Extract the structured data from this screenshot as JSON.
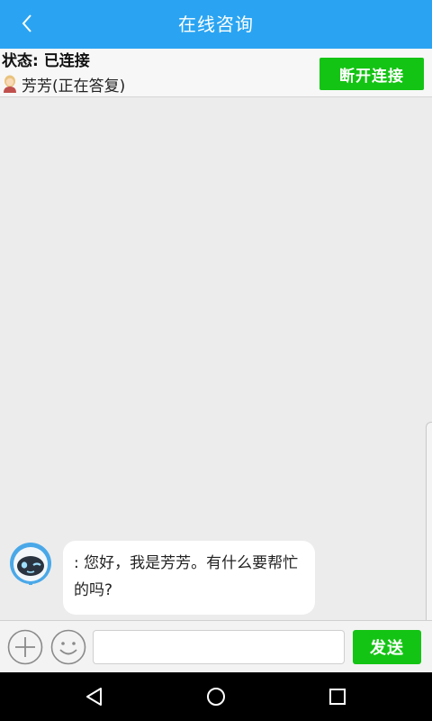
{
  "appbar": {
    "title": "在线咨询",
    "back_icon": "chevron-left-icon",
    "color": "#2aa4f2"
  },
  "status": {
    "connection_label": "状态: 已连接",
    "agent_name": "芳芳",
    "agent_state": " (正在答复)",
    "agent_icon": "user-avatar-icon",
    "disconnect_label": "断开连接",
    "button_color": "#14c414"
  },
  "chat": {
    "messages": [
      {
        "sender_icon": "robot-avatar-icon",
        "text": ": 您好，我是芳芳。有什么要帮忙的吗?"
      }
    ]
  },
  "input_bar": {
    "plus_icon": "plus-circle-icon",
    "emoji_icon": "smiley-icon",
    "input_value": "",
    "send_label": "发送"
  },
  "navbar": {
    "back_icon": "nav-back-icon",
    "home_icon": "nav-home-icon",
    "recent_icon": "nav-recent-apps-icon"
  }
}
